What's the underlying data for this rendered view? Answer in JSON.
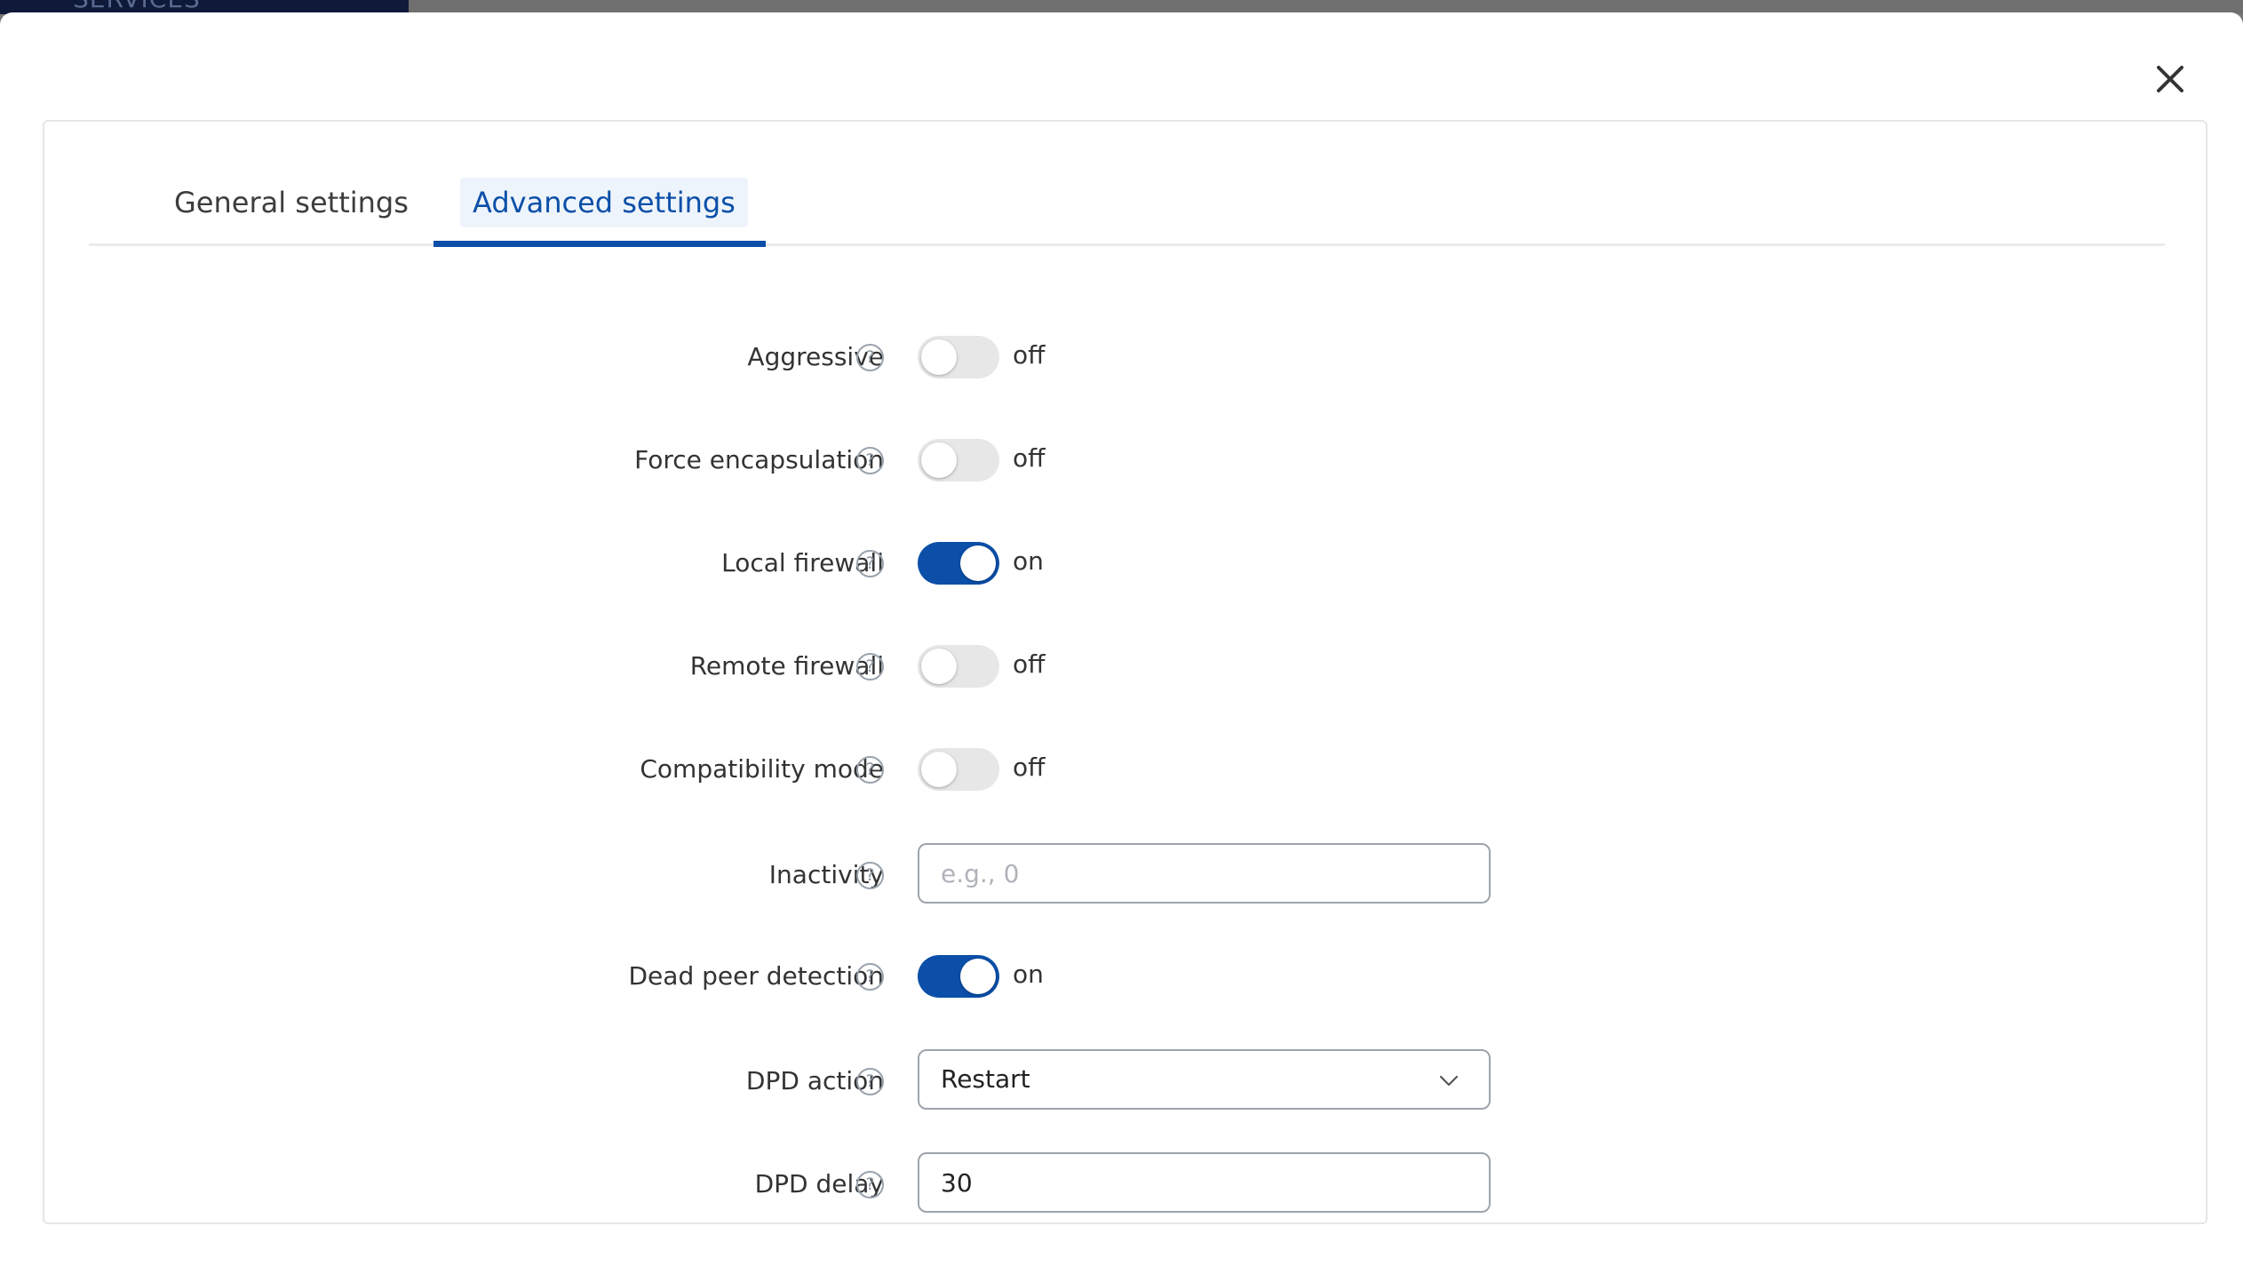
{
  "background": {
    "header_text": "SERVICES"
  },
  "modal": {
    "close_icon": "close-icon"
  },
  "tabs": [
    {
      "label": "General settings",
      "active": false
    },
    {
      "label": "Advanced settings",
      "active": true
    }
  ],
  "colors": {
    "accent": "#0b4fa8",
    "toggle_off": "#e7e7e7"
  },
  "fields": {
    "aggressive": {
      "label": "Aggressive",
      "state": "off"
    },
    "force_encapsulation": {
      "label": "Force encapsulation",
      "state": "off"
    },
    "local_firewall": {
      "label": "Local firewall",
      "state": "on"
    },
    "remote_firewall": {
      "label": "Remote firewall",
      "state": "off"
    },
    "compatibility_mode": {
      "label": "Compatibility mode",
      "state": "off"
    },
    "inactivity": {
      "label": "Inactivity",
      "value": "",
      "placeholder": "e.g., 0"
    },
    "dead_peer_detection": {
      "label": "Dead peer detection",
      "state": "on"
    },
    "dpd_action": {
      "label": "DPD action",
      "value": "Restart"
    },
    "dpd_delay": {
      "label": "DPD delay",
      "value": "30"
    }
  },
  "help_glyph": "?"
}
